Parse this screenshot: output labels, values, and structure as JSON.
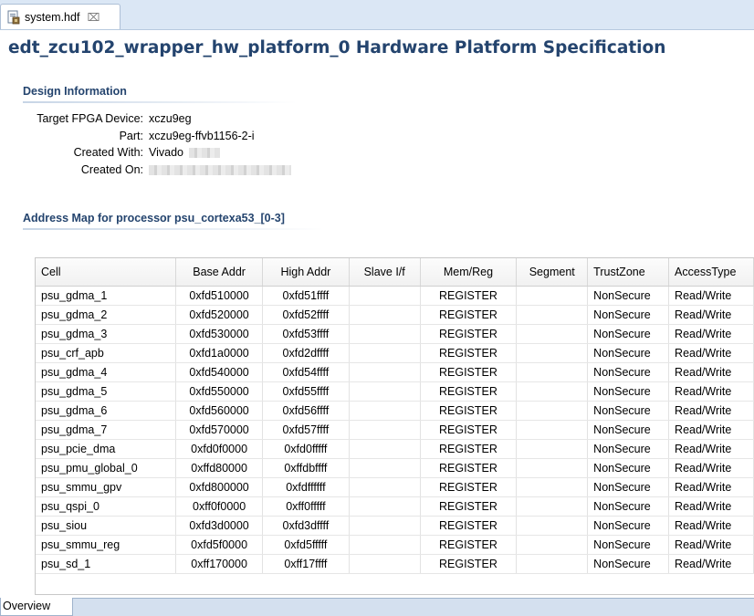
{
  "editor_tab": {
    "label": "system.hdf",
    "close_glyph": "⌧",
    "icon": "hdf-file-icon"
  },
  "page_title": "edt_zcu102_wrapper_hw_platform_0 Hardware Platform Specification",
  "design_info": {
    "title": "Design Information",
    "rows": [
      {
        "key": "Target FPGA Device:",
        "value": "xczu9eg"
      },
      {
        "key": "Part:",
        "value": "xczu9eg-ffvb1156-2-i"
      },
      {
        "key": "Created With:",
        "value": "Vivado"
      },
      {
        "key": "Created On:",
        "value": ""
      }
    ]
  },
  "address_map": {
    "title": "Address Map for processor psu_cortexa53_[0-3]",
    "columns": [
      "Cell",
      "Base Addr",
      "High Addr",
      "Slave I/f",
      "Mem/Reg",
      "Segment",
      "TrustZone",
      "AccessType"
    ],
    "rows": [
      [
        "psu_gdma_1",
        "0xfd510000",
        "0xfd51ffff",
        "",
        "REGISTER",
        "",
        "NonSecure",
        "Read/Write"
      ],
      [
        "psu_gdma_2",
        "0xfd520000",
        "0xfd52ffff",
        "",
        "REGISTER",
        "",
        "NonSecure",
        "Read/Write"
      ],
      [
        "psu_gdma_3",
        "0xfd530000",
        "0xfd53ffff",
        "",
        "REGISTER",
        "",
        "NonSecure",
        "Read/Write"
      ],
      [
        "psu_crf_apb",
        "0xfd1a0000",
        "0xfd2dffff",
        "",
        "REGISTER",
        "",
        "NonSecure",
        "Read/Write"
      ],
      [
        "psu_gdma_4",
        "0xfd540000",
        "0xfd54ffff",
        "",
        "REGISTER",
        "",
        "NonSecure",
        "Read/Write"
      ],
      [
        "psu_gdma_5",
        "0xfd550000",
        "0xfd55ffff",
        "",
        "REGISTER",
        "",
        "NonSecure",
        "Read/Write"
      ],
      [
        "psu_gdma_6",
        "0xfd560000",
        "0xfd56ffff",
        "",
        "REGISTER",
        "",
        "NonSecure",
        "Read/Write"
      ],
      [
        "psu_gdma_7",
        "0xfd570000",
        "0xfd57ffff",
        "",
        "REGISTER",
        "",
        "NonSecure",
        "Read/Write"
      ],
      [
        "psu_pcie_dma",
        "0xfd0f0000",
        "0xfd0fffff",
        "",
        "REGISTER",
        "",
        "NonSecure",
        "Read/Write"
      ],
      [
        "psu_pmu_global_0",
        "0xffd80000",
        "0xffdbffff",
        "",
        "REGISTER",
        "",
        "NonSecure",
        "Read/Write"
      ],
      [
        "psu_smmu_gpv",
        "0xfd800000",
        "0xfdffffff",
        "",
        "REGISTER",
        "",
        "NonSecure",
        "Read/Write"
      ],
      [
        "psu_qspi_0",
        "0xff0f0000",
        "0xff0fffff",
        "",
        "REGISTER",
        "",
        "NonSecure",
        "Read/Write"
      ],
      [
        "psu_siou",
        "0xfd3d0000",
        "0xfd3dffff",
        "",
        "REGISTER",
        "",
        "NonSecure",
        "Read/Write"
      ],
      [
        "psu_smmu_reg",
        "0xfd5f0000",
        "0xfd5fffff",
        "",
        "REGISTER",
        "",
        "NonSecure",
        "Read/Write"
      ],
      [
        "psu_sd_1",
        "0xff170000",
        "0xff17ffff",
        "",
        "REGISTER",
        "",
        "NonSecure",
        "Read/Write"
      ]
    ]
  },
  "bottom_tab": {
    "label": "Overview"
  }
}
